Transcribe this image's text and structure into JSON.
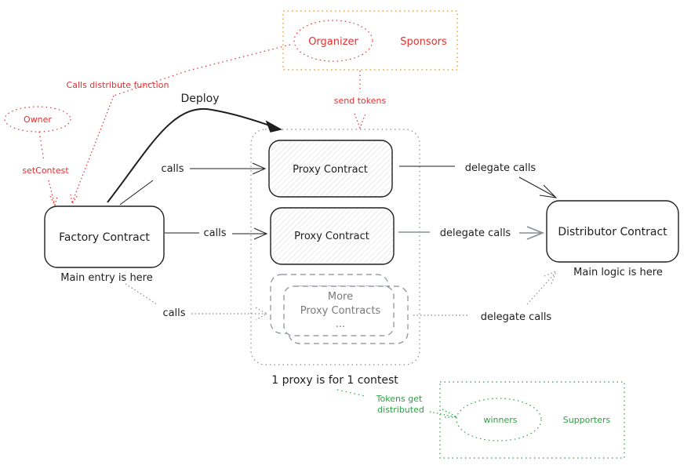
{
  "colors": {
    "ink": "#1e1e1e",
    "gray": "#868e96",
    "red": "#e03131",
    "orange": "#f08c00",
    "green": "#2f9e44"
  },
  "nodes": {
    "factory": {
      "label": "Factory Contract",
      "caption": "Main entry is here"
    },
    "proxy1": {
      "label": "Proxy Contract"
    },
    "proxy2": {
      "label": "Proxy Contract"
    },
    "more_proxies": {
      "line1": "More",
      "line2": "Proxy Contracts",
      "line3": "..."
    },
    "distributor": {
      "label": "Distributor Contract",
      "caption": "Main logic is here"
    },
    "proxy_group_caption": "1 proxy is for 1 contest",
    "owner": "Owner",
    "organizer": "Organizer",
    "sponsors": "Sponsors",
    "winners": "winners",
    "supporters": "Supporters"
  },
  "edges": {
    "deploy": "Deploy",
    "calls1": "calls",
    "calls2": "calls",
    "calls3": "calls",
    "delegate1": "delegate calls",
    "delegate2": "delegate calls",
    "delegate3": "delegate calls",
    "set_contest": "setContest",
    "calls_distribute": "Calls distribute function",
    "send_tokens": "send tokens",
    "tokens_get_1": "Tokens get",
    "tokens_get_2": "distributed"
  }
}
